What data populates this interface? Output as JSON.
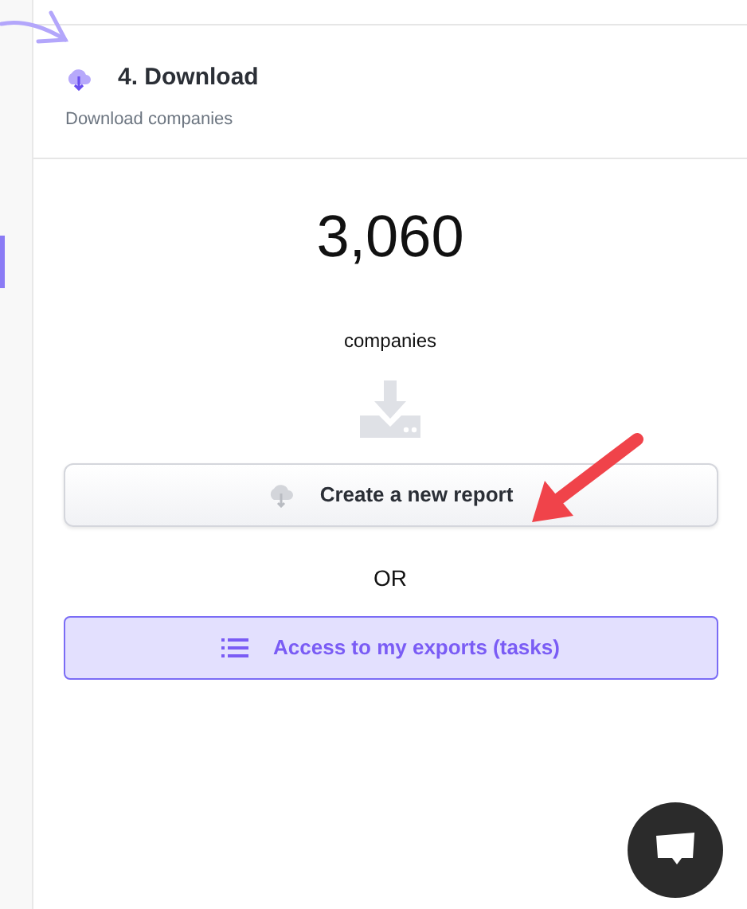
{
  "step": {
    "title": "4. Download",
    "subtitle": "Download companies"
  },
  "result": {
    "count": "3,060",
    "label": "companies"
  },
  "primary_action": {
    "label": "Create a new report"
  },
  "separator": "OR",
  "secondary_action": {
    "label": "Access to my exports (tasks)"
  }
}
